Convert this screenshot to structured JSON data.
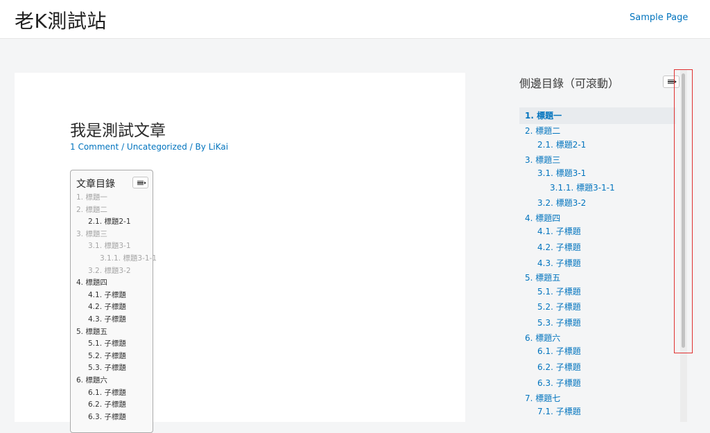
{
  "site": {
    "title": "老K測試站",
    "nav_link": "Sample Page"
  },
  "post": {
    "title": "我是測試文章",
    "meta": {
      "comments": "1 Comment",
      "sep1": " / ",
      "category": "Uncategorized",
      "sep2": " / By ",
      "author": "LiKai"
    }
  },
  "toc": {
    "title": "文章目錄",
    "items": [
      "1. 標題一",
      "2. 標題二",
      "2.1. 標題2-1",
      "3. 標題三",
      "3.1. 標題3-1",
      "3.1.1. 標題3-1-1",
      "3.2. 標題3-2",
      "4. 標題四",
      "4.1. 子標題",
      "4.2. 子標題",
      "4.3. 子標題",
      "5. 標題五",
      "5.1. 子標題",
      "5.2. 子標題",
      "5.3. 子標題",
      "6. 標題六",
      "6.1. 子標題",
      "6.2. 子標題",
      "6.3. 子標題"
    ]
  },
  "sidebar": {
    "title": "側邊目錄（可滾動）",
    "items": [
      "1. 標題一",
      "2. 標題二",
      "2.1. 標題2-1",
      "3. 標題三",
      "3.1. 標題3-1",
      "3.1.1. 標題3-1-1",
      "3.2. 標題3-2",
      "4. 標題四",
      "4.1. 子標題",
      "4.2. 子標題",
      "4.3. 子標題",
      "5. 標題五",
      "5.1. 子標題",
      "5.2. 子標題",
      "5.3. 子標題",
      "6. 標題六",
      "6.1. 子標題",
      "6.2. 子標題",
      "6.3. 子標題",
      "7. 標題七",
      "7.1. 子標題"
    ]
  },
  "colors": {
    "link": "#0274be",
    "highlight": "#e03030"
  },
  "icons": {
    "toc_toggle": "list-toggle-icon"
  }
}
